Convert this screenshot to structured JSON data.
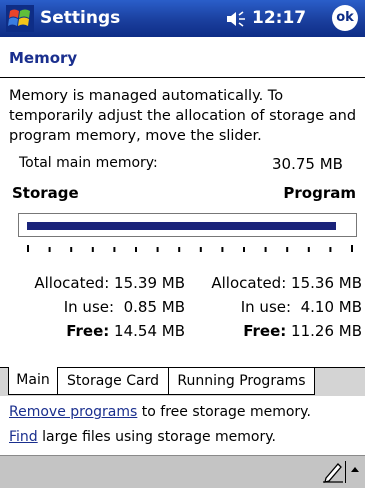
{
  "titlebar": {
    "title": "Settings",
    "time": "12:17",
    "ok_label": "ok"
  },
  "page": {
    "title": "Memory",
    "description": "Memory is managed automatically. To temporarily adjust the allocation of storage and program memory, move the slider."
  },
  "total": {
    "label": "Total main memory:",
    "value": "30.75 MB"
  },
  "slider": {
    "left_label": "Storage",
    "right_label": "Program",
    "position_fraction": 0.5
  },
  "storage": {
    "allocated_label": "Allocated:",
    "allocated": "15.39 MB",
    "inuse_label": "In use:",
    "inuse": "0.85 MB",
    "free_label": "Free:",
    "free": "14.54 MB"
  },
  "program": {
    "allocated_label": "Allocated:",
    "allocated": "15.36 MB",
    "inuse_label": "In use:",
    "inuse": "4.10 MB",
    "free_label": "Free:",
    "free": "11.26 MB"
  },
  "tabs": [
    "Main",
    "Storage Card",
    "Running Programs"
  ],
  "links": {
    "line1_link": "Remove programs",
    "line1_rest": " to free storage memory.",
    "line2_link": "Find",
    "line2_rest": " large files using storage memory."
  },
  "colors": {
    "titlebar": "#1a3f9e",
    "accent": "#1a2f8e",
    "slider_fill": "#1a237a"
  }
}
